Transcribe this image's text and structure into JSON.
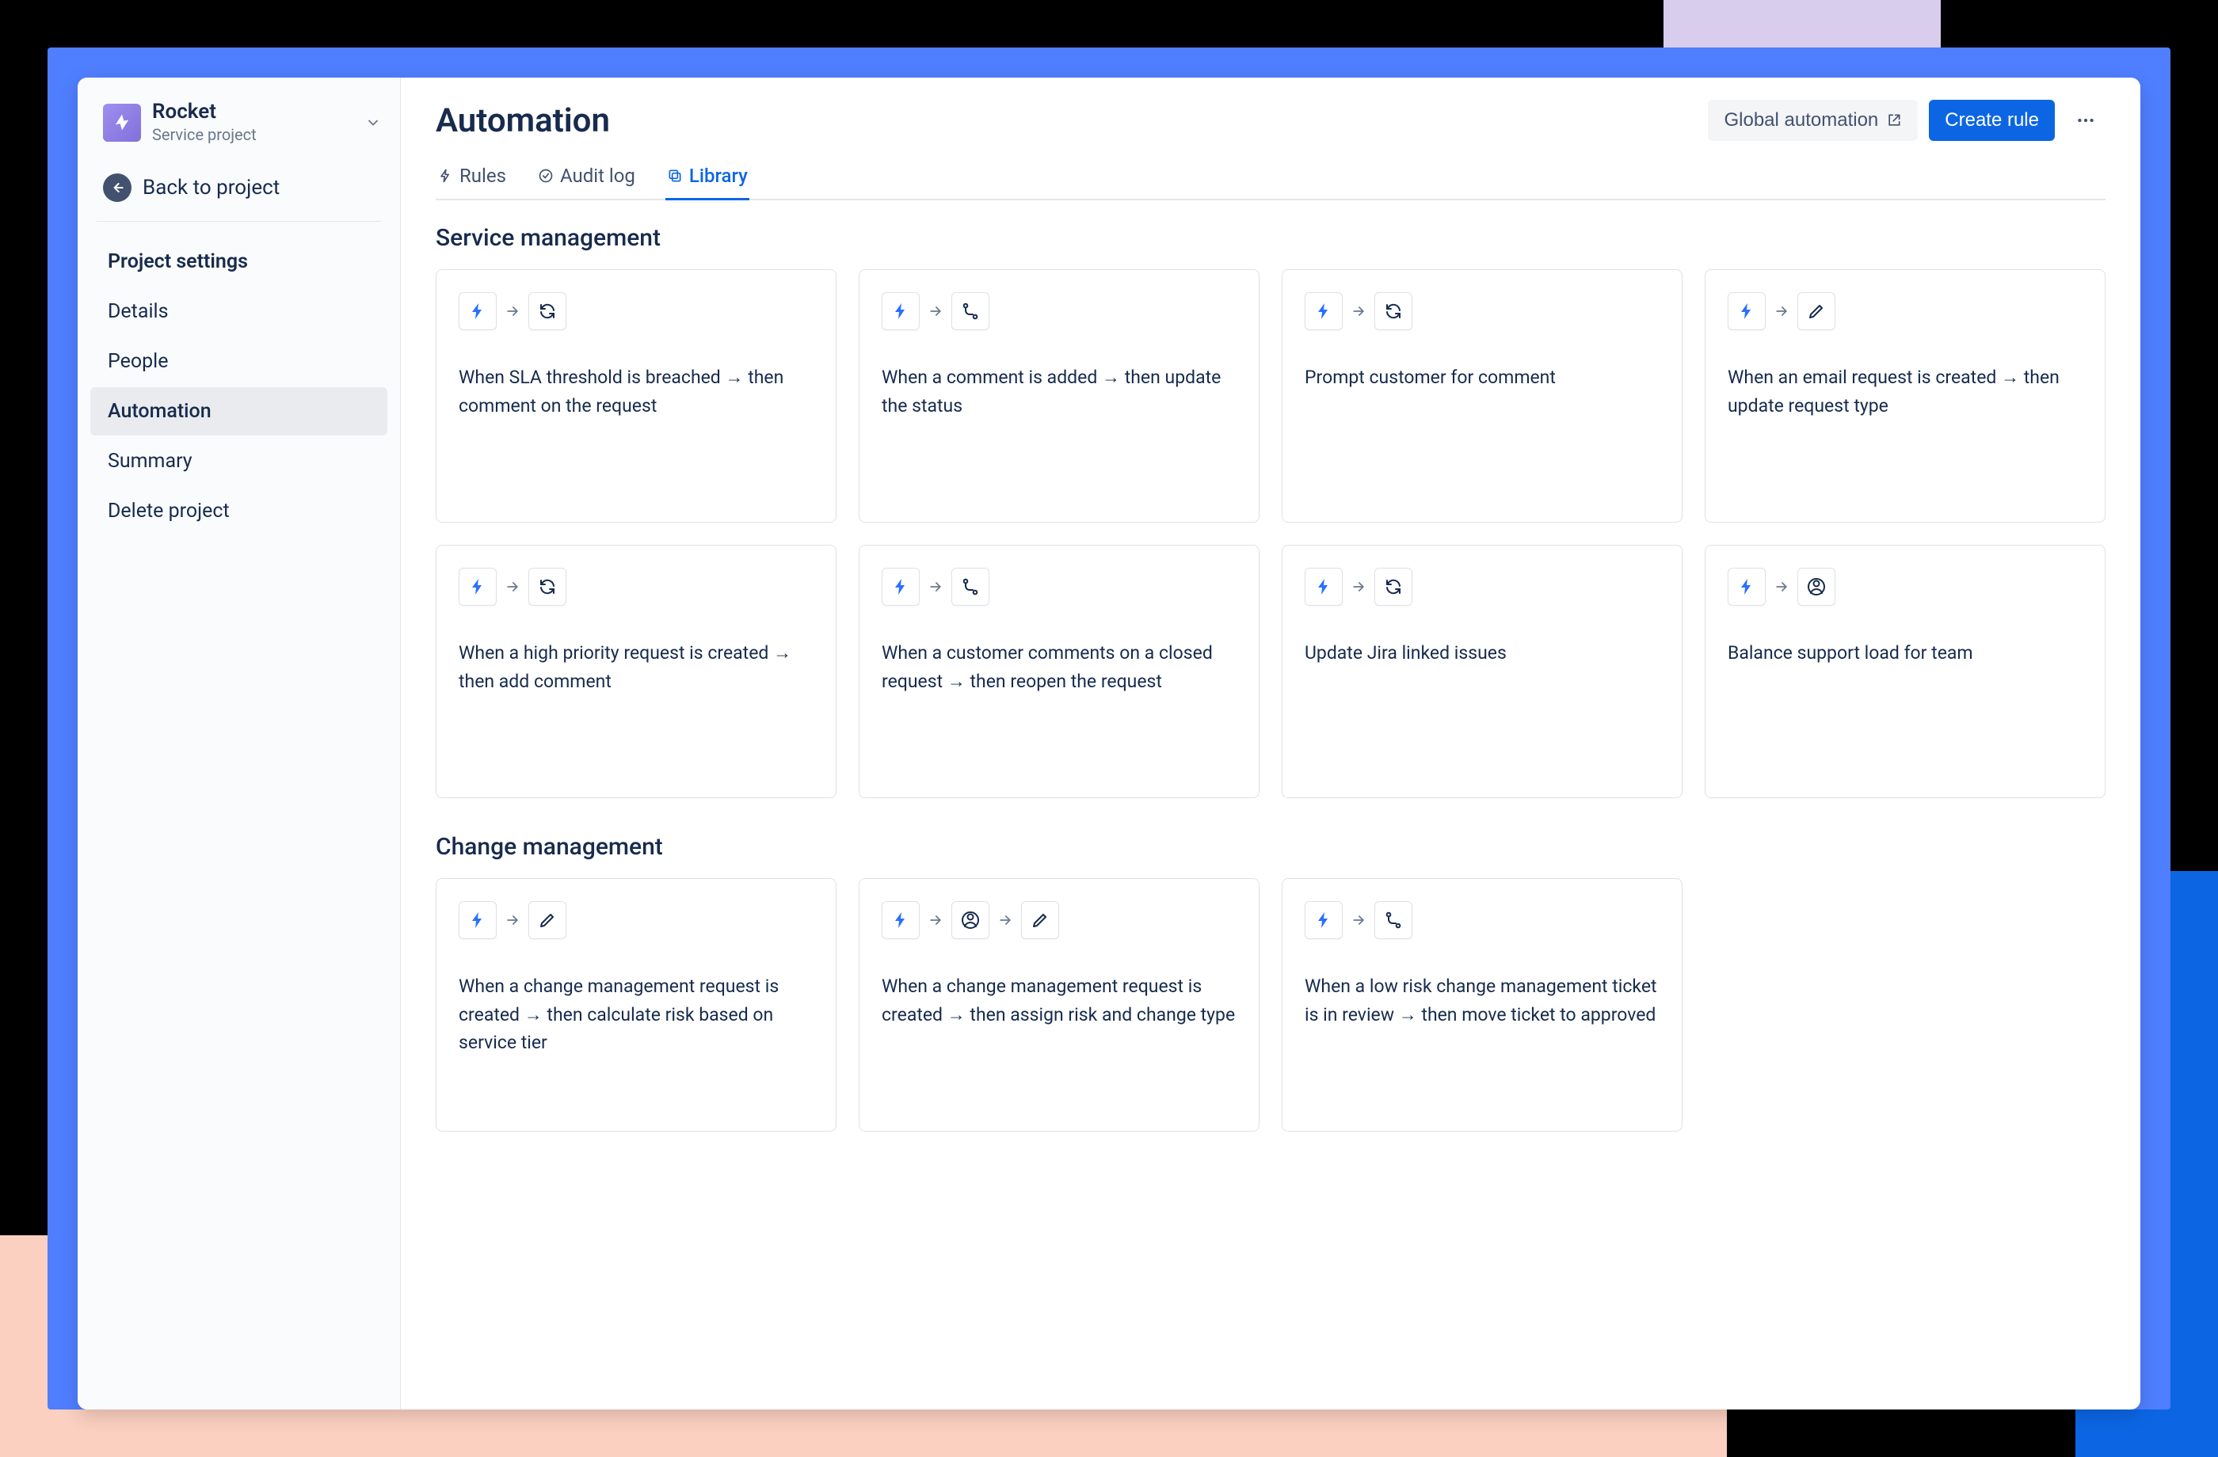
{
  "sidebar": {
    "project_name": "Rocket",
    "project_sub": "Service project",
    "back_label": "Back to project",
    "items": [
      {
        "label": "Project settings",
        "heading": true
      },
      {
        "label": "Details"
      },
      {
        "label": "People"
      },
      {
        "label": "Automation",
        "active": true
      },
      {
        "label": "Summary"
      },
      {
        "label": "Delete project"
      }
    ]
  },
  "header": {
    "title": "Automation",
    "global_label": "Global automation",
    "create_label": "Create rule"
  },
  "tabs": [
    {
      "id": "rules",
      "label": "Rules",
      "icon": "bolt"
    },
    {
      "id": "audit",
      "label": "Audit log",
      "icon": "check-circle"
    },
    {
      "id": "library",
      "label": "Library",
      "icon": "copy",
      "active": true
    }
  ],
  "sections": [
    {
      "title": "Service management",
      "cards": [
        {
          "icons": [
            "bolt",
            "refresh"
          ],
          "text": "When SLA threshold is breached → then comment on the request"
        },
        {
          "icons": [
            "bolt",
            "branch"
          ],
          "text": "When a comment is added → then update the status"
        },
        {
          "icons": [
            "bolt",
            "refresh"
          ],
          "text": "Prompt customer for comment"
        },
        {
          "icons": [
            "bolt",
            "edit"
          ],
          "text": "When an email request is created → then update request type"
        },
        {
          "icons": [
            "bolt",
            "refresh"
          ],
          "text": "When a high priority request is created → then add comment"
        },
        {
          "icons": [
            "bolt",
            "branch"
          ],
          "text": "When a customer comments on a closed request → then reopen the request"
        },
        {
          "icons": [
            "bolt",
            "refresh"
          ],
          "text": "Update Jira linked issues"
        },
        {
          "icons": [
            "bolt",
            "user"
          ],
          "text": "Balance support load for team"
        }
      ]
    },
    {
      "title": "Change management",
      "cards": [
        {
          "icons": [
            "bolt",
            "edit"
          ],
          "text": "When a change management request is created → then calculate risk based on service tier"
        },
        {
          "icons": [
            "bolt",
            "user",
            "edit"
          ],
          "text": "When a change management request is created → then assign risk and change type"
        },
        {
          "icons": [
            "bolt",
            "branch"
          ],
          "text": "When a low risk change management ticket is in review → then move ticket to approved"
        }
      ]
    }
  ]
}
